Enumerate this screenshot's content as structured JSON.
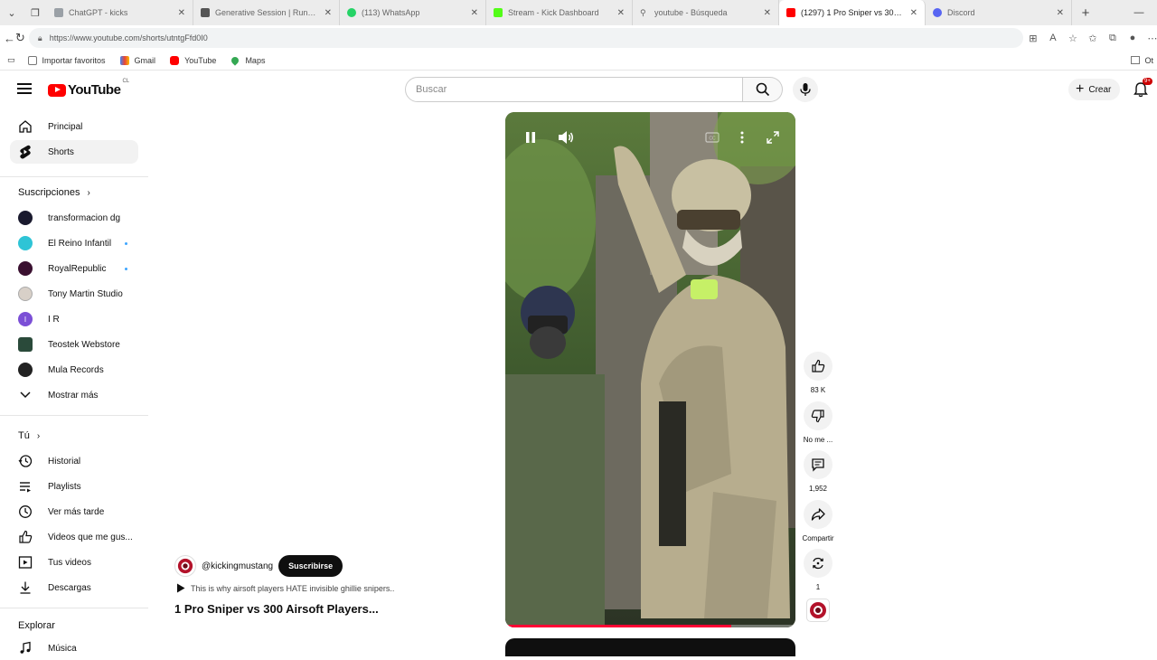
{
  "browser": {
    "tabs": [
      {
        "label": "ChatGPT - kicks",
        "color": "#9aa0a6"
      },
      {
        "label": "Generative Session | Runway AI",
        "color": "#555555"
      },
      {
        "label": "(113) WhatsApp",
        "color": "#25d366"
      },
      {
        "label": "Stream - Kick Dashboard",
        "color": "#53fc18"
      },
      {
        "label": "youtube - Búsqueda",
        "color": "#9aa0a6"
      },
      {
        "label": "(1297) 1 Pro Sniper vs 300 Ai...",
        "color": "#ff0000",
        "active": true
      },
      {
        "label": "Discord",
        "color": "#5865f2"
      }
    ],
    "url": "https://www.youtube.com/shorts/utntgFfd0I0",
    "bookmarks": [
      {
        "label": "Importar favoritos",
        "icon": "import-icon"
      },
      {
        "label": "Gmail",
        "icon": "gmail-icon"
      },
      {
        "label": "YouTube",
        "icon": "youtube-icon"
      },
      {
        "label": "Maps",
        "icon": "maps-icon"
      }
    ],
    "bookmarks_right": "Ot"
  },
  "header": {
    "logo_text": "YouTube",
    "country": "CL",
    "search_placeholder": "Buscar",
    "create_label": "Crear",
    "notif_badge": "9+"
  },
  "sidebar": {
    "main": [
      {
        "label": "Principal",
        "icon": "home-icon"
      },
      {
        "label": "Shorts",
        "icon": "shorts-icon",
        "active": true
      }
    ],
    "subs_title": "Suscripciones",
    "subscriptions": [
      {
        "label": "transformacion dg",
        "color": "#1a1a2e",
        "dot": false
      },
      {
        "label": "El Reino Infantil",
        "color": "#2ec4d6",
        "dot": true
      },
      {
        "label": "RoyalRepublic",
        "color": "#3a1030",
        "dot": true
      },
      {
        "label": "Tony Martin Studio",
        "color": "#d8d0c8",
        "dot": false
      },
      {
        "label": "I R",
        "color": "#7b4fd6",
        "letter": "I",
        "dot": false
      },
      {
        "label": "Teostek Webstore",
        "color": "#2a4a3a",
        "dot": false
      },
      {
        "label": "Mula Records",
        "color": "#222222",
        "dot": false
      }
    ],
    "show_more": "Mostrar más",
    "you_title": "Tú",
    "you_items": [
      {
        "label": "Historial",
        "icon": "history-icon"
      },
      {
        "label": "Playlists",
        "icon": "playlists-icon"
      },
      {
        "label": "Ver más tarde",
        "icon": "watch-later-icon"
      },
      {
        "label": "Videos que me gus...",
        "icon": "liked-icon"
      },
      {
        "label": "Tus videos",
        "icon": "your-videos-icon"
      },
      {
        "label": "Descargas",
        "icon": "downloads-icon"
      }
    ],
    "explore_title": "Explorar",
    "explore_items": [
      {
        "label": "Música",
        "icon": "music-icon"
      }
    ]
  },
  "short": {
    "channel": "@kickingmustang",
    "subscribe": "Suscribirse",
    "description": "This is why airsoft players HATE invisible ghillie snipers..",
    "title": "1 Pro Sniper vs 300 Airsoft Players...",
    "progress": 0.78
  },
  "actions": [
    {
      "name": "like",
      "label": "83 K",
      "icon": "thumbs-up-icon"
    },
    {
      "name": "dislike",
      "label": "No me ...",
      "icon": "thumbs-down-icon"
    },
    {
      "name": "comments",
      "label": "1,952",
      "icon": "comment-icon"
    },
    {
      "name": "share",
      "label": "Compartir",
      "icon": "share-icon"
    },
    {
      "name": "remix",
      "label": "1",
      "icon": "remix-icon"
    }
  ]
}
